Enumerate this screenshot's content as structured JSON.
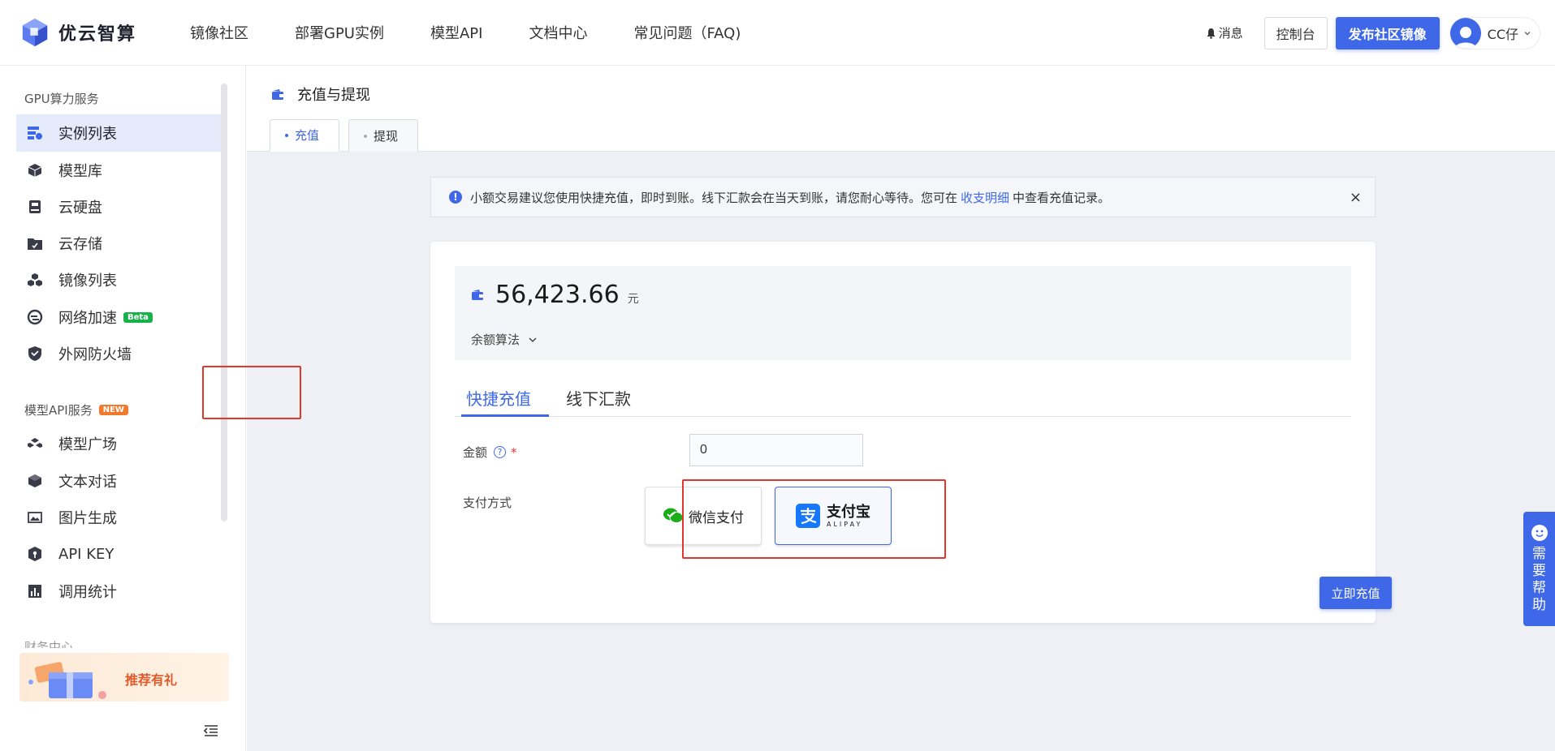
{
  "brand": {
    "name": "优云智算"
  },
  "nav": [
    "镜像社区",
    "部署GPU实例",
    "模型API",
    "文档中心",
    "常见问题（FAQ)"
  ],
  "top_right": {
    "messages": "消息",
    "console": "控制台",
    "publish": "发布社区镜像",
    "user_name": "CC仔"
  },
  "sidebar": {
    "group1": "GPU算力服务",
    "group1_items": [
      "实例列表",
      "模型库",
      "云硬盘",
      "云存储",
      "镜像列表",
      "网络加速",
      "外网防火墙"
    ],
    "beta_badge": "Beta",
    "group2": "模型API服务",
    "new_badge": "NEW",
    "group2_items": [
      "模型广场",
      "文本对话",
      "图片生成",
      "API KEY",
      "调用统计"
    ],
    "group3_partial": "财务中心",
    "promo_text": "推荐有礼"
  },
  "page": {
    "title": "充值与提现",
    "tabs": [
      "充值",
      "提现"
    ]
  },
  "alert": {
    "text_before": "小额交易建议您使用快捷充值，即时到账。线下汇款会在当天到账，请您耐心等待。您可在",
    "link": "收支明细",
    "text_after": "中查看充值记录。",
    "close": "×"
  },
  "balance": {
    "amount": "56,423.66",
    "unit": "元",
    "algo_label": "余额算法"
  },
  "pay_tabs": [
    "快捷充值",
    "线下汇款"
  ],
  "form": {
    "amount_label": "金额",
    "amount_value": "0",
    "required_mark": "*",
    "help_mark": "?",
    "method_label": "支付方式",
    "wechat": "微信支付",
    "alipay_cn": "支付宝",
    "alipay_en": "ALIPAY",
    "submit": "立即充值"
  },
  "help_float": [
    "需",
    "要",
    "帮",
    "助"
  ],
  "colors": {
    "accent": "#3f68e8",
    "highlight_box": "#e0382c",
    "wechat": "#1aad19",
    "alipay": "#1677ff"
  }
}
